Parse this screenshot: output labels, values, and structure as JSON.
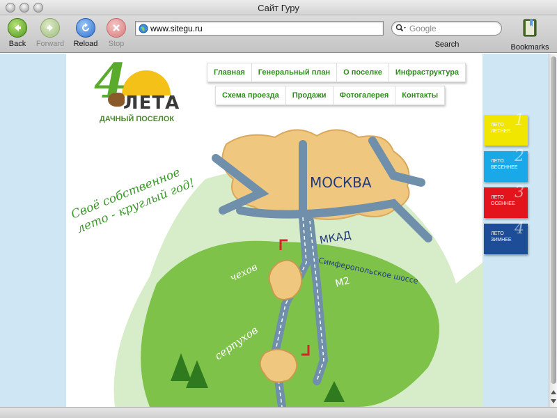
{
  "window": {
    "title": "Сайт Гуру"
  },
  "toolbar": {
    "back_label": "Back",
    "forward_label": "Forward",
    "reload_label": "Reload",
    "stop_label": "Stop",
    "url": "www.sitegu.ru",
    "search_placeholder": "Google",
    "search_label": "Search",
    "bookmarks_label": "Bookmarks"
  },
  "site": {
    "logo": {
      "number": "4",
      "name": "ЛЕТА",
      "subtitle": "ДАЧНЫЙ ПОСЕЛОК"
    },
    "nav_top": [
      "Главная",
      "Генеральный план",
      "О поселке",
      "Инфраструктура"
    ],
    "nav_bottom": [
      "Схема проезда",
      "Продажи",
      "Фотогалерея",
      "Контакты"
    ],
    "slogan_line1": "Своё собственное",
    "slogan_line2": "лето - круглый год!",
    "map": {
      "city": "МОСКВА",
      "ring": "МКАД",
      "highway": "Симферопольское шоссе",
      "route": "М2",
      "town1": "чехов",
      "town2": "серпухов"
    },
    "seasons": [
      {
        "label1": "ЛЕТО",
        "label2": "ЛЕТНЕЕ",
        "num": "1",
        "color": "#f0e600"
      },
      {
        "label1": "ЛЕТО",
        "label2": "ВЕСЕННЕЕ",
        "num": "2",
        "color": "#19a9e8"
      },
      {
        "label1": "ЛЕТО",
        "label2": "ОСЕННЕЕ",
        "num": "3",
        "color": "#e3141b"
      },
      {
        "label1": "ЛЕТО",
        "label2": "ЗИМНЕЕ",
        "num": "4",
        "color": "#1d4d96"
      }
    ]
  }
}
